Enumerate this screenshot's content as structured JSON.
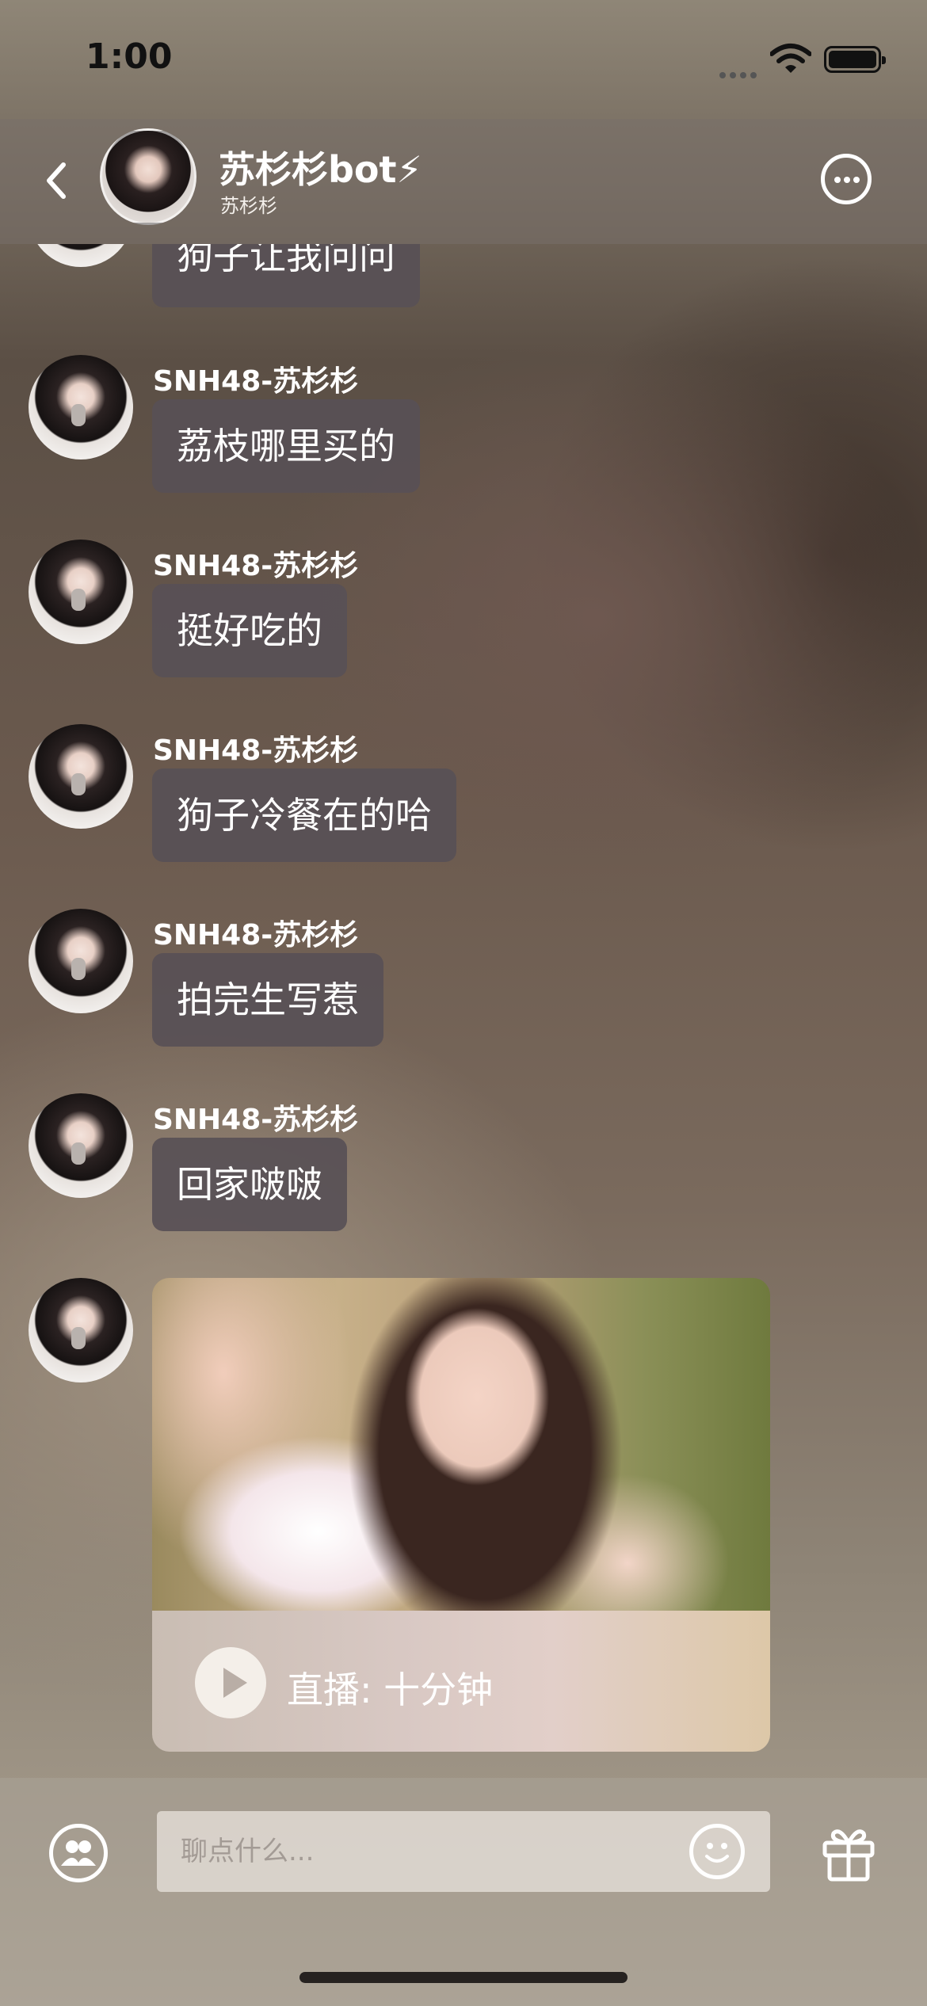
{
  "status_bar": {
    "time": "1:00"
  },
  "header": {
    "title": "苏杉杉bot⚡",
    "subtitle": "苏杉杉",
    "icons": {
      "back": "chevron-left-icon",
      "more": "more-circle-icon"
    }
  },
  "messages": [
    {
      "sender": "",
      "text": "狗子让我问问"
    },
    {
      "sender": "SNH48-苏杉杉",
      "text": "荔枝哪里买的"
    },
    {
      "sender": "SNH48-苏杉杉",
      "text": "挺好吃的"
    },
    {
      "sender": "SNH48-苏杉杉",
      "text": "狗子冷餐在的哈"
    },
    {
      "sender": "SNH48-苏杉杉",
      "text": "拍完生写惹"
    },
    {
      "sender": "SNH48-苏杉杉",
      "text": "回家啵啵"
    }
  ],
  "live_card": {
    "label": "直播: 十分钟",
    "icon": "play-icon"
  },
  "footer": {
    "input_placeholder": "聊点什么...",
    "icons": {
      "members": "people-icon",
      "emoji": "smiley-icon",
      "gift": "gift-icon"
    }
  }
}
